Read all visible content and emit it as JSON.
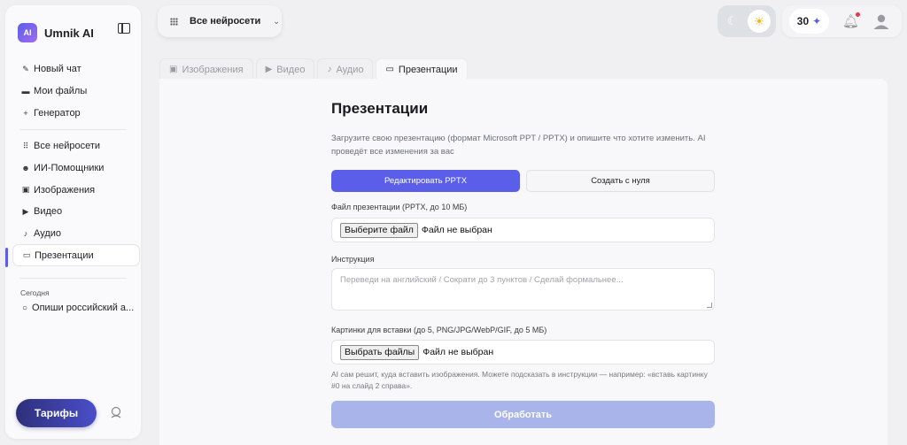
{
  "app": {
    "name": "Umnik AI",
    "logo_text": "AI"
  },
  "sidebar": {
    "primary": [
      {
        "label": "Новый чат",
        "icon": "pencil-icon"
      },
      {
        "label": "Мои файлы",
        "icon": "folder-icon"
      },
      {
        "label": "Генератор",
        "icon": "sparkle-icon"
      }
    ],
    "secondary": [
      {
        "label": "Все нейросети",
        "icon": "grid-icon"
      },
      {
        "label": "ИИ-Помощники",
        "icon": "robot-icon"
      },
      {
        "label": "Изображения",
        "icon": "image-icon"
      },
      {
        "label": "Видео",
        "icon": "video-icon"
      },
      {
        "label": "Аудио",
        "icon": "audio-icon"
      },
      {
        "label": "Презентации",
        "icon": "presentation-icon",
        "active": true
      }
    ],
    "history_section": "Сегодня",
    "history_items": [
      {
        "label": "Опиши российский а..."
      }
    ],
    "tariffs_label": "Тарифы"
  },
  "topbar": {
    "model_select": "Все нейросети",
    "credits": "30",
    "theme": "light"
  },
  "tabs": [
    {
      "label": "Изображения",
      "icon": "image-icon"
    },
    {
      "label": "Видео",
      "icon": "video-icon"
    },
    {
      "label": "Аудио",
      "icon": "audio-icon"
    },
    {
      "label": "Презентации",
      "icon": "presentation-icon",
      "active": true
    }
  ],
  "form": {
    "title": "Презентации",
    "subtitle": "Загрузите свою презентацию (формат Microsoft PPT / PPTX) и опишите что хотите изменить. AI проведёт все изменения за вас",
    "mode_edit": "Редактировать PPTX",
    "mode_create": "Создать с нуля",
    "file_label": "Файл презентации (PPTX, до 10 МБ)",
    "file_button": "Выберите файл",
    "file_status": "Файл не выбран",
    "instruction_label": "Инструкция",
    "instruction_placeholder": "Переведи на английский / Сократи до 3 пунктов / Сделай формальнее...",
    "images_label": "Картинки для вставки (до 5, PNG/JPG/WebP/GIF, до 5 МБ)",
    "images_button": "Выбрать файлы",
    "images_status": "Файл не выбран",
    "hint": "AI сам решит, куда вставить изображения. Можете подсказать в инструкции — например: «вставь картинку #0 на слайд 2 справа».",
    "submit": "Обработать"
  },
  "colors": {
    "accent": "#5b5ee8",
    "submit_disabled": "#a9b4ea",
    "tariffs_gradient_start": "#2d2f7a"
  }
}
